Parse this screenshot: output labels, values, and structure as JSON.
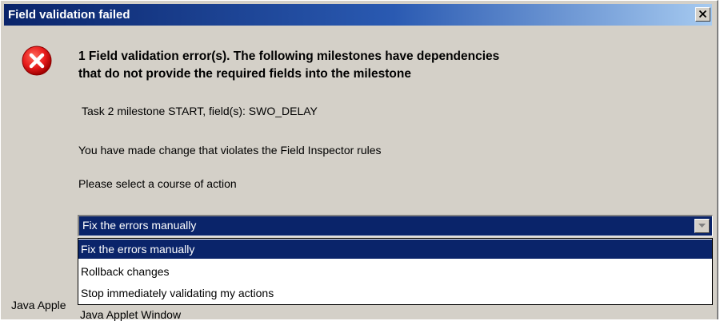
{
  "window": {
    "title": "Field validation failed",
    "close_label": "close"
  },
  "message": {
    "heading_line1": "1 Field validation error(s). The following milestones have dependencies",
    "heading_line2": "that do not provide the required fields into the milestone",
    "detail": "Task 2 milestone START, field(s):  SWO_DELAY",
    "violation": "You have made change that violates the Field Inspector rules",
    "prompt": "Please select a course of action"
  },
  "action_select": {
    "selected": "Fix the errors manually",
    "options": [
      {
        "label": "Fix the errors manually",
        "selected": true
      },
      {
        "label": "Rollback changes",
        "selected": false
      },
      {
        "label": "Stop immediately validating my actions",
        "selected": false
      }
    ]
  },
  "footer": {
    "applet_label_clipped": "Java Apple",
    "applet_label": "Java Applet Window"
  },
  "icons": {
    "error": "error-icon",
    "close": "close-icon",
    "dropdown_arrow": "chevron-down-icon"
  },
  "colors": {
    "titlebar_start": "#0a246a",
    "titlebar_end": "#a6caf0",
    "dialog_face": "#d4d0c8",
    "selection": "#0a246a",
    "error_red": "#e81c1c"
  }
}
